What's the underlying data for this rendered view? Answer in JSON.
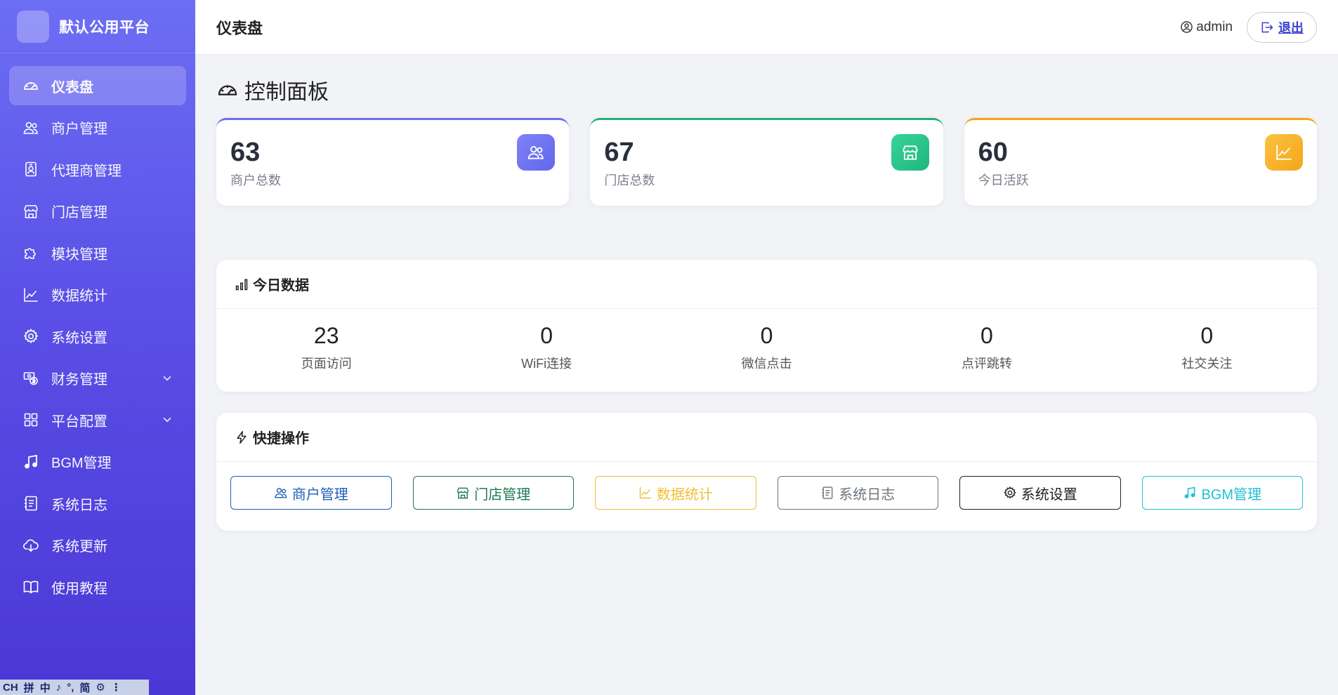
{
  "brand": {
    "name": "默认公用平台"
  },
  "sidebar": {
    "items": [
      {
        "label": "仪表盘",
        "icon": "speedometer-icon",
        "active": true
      },
      {
        "label": "商户管理",
        "icon": "people-icon"
      },
      {
        "label": "代理商管理",
        "icon": "person-badge-icon"
      },
      {
        "label": "门店管理",
        "icon": "shop-icon"
      },
      {
        "label": "模块管理",
        "icon": "puzzle-icon"
      },
      {
        "label": "数据统计",
        "icon": "graph-up-icon"
      },
      {
        "label": "系统设置",
        "icon": "gear-icon"
      },
      {
        "label": "财务管理",
        "icon": "cash-coin-icon",
        "expandable": true
      },
      {
        "label": "平台配置",
        "icon": "grid-icon",
        "expandable": true
      },
      {
        "label": "BGM管理",
        "icon": "music-note-icon"
      },
      {
        "label": "系统日志",
        "icon": "journal-text-icon"
      },
      {
        "label": "系统更新",
        "icon": "cloud-download-icon"
      },
      {
        "label": "使用教程",
        "icon": "book-icon"
      }
    ]
  },
  "ime": {
    "items": [
      "CH",
      "拼",
      "中",
      "♪",
      "°,",
      "简",
      "⚙",
      "⋮"
    ]
  },
  "header": {
    "title": "仪表盘",
    "user": "admin",
    "logout_label": "退出"
  },
  "dashboard": {
    "title": "控制面板",
    "stats": [
      {
        "value": "63",
        "label": "商户总数",
        "accent": "#6a6ef0"
      },
      {
        "value": "67",
        "label": "门店总数",
        "accent": "#22b07a"
      },
      {
        "value": "60",
        "label": "今日活跃",
        "accent": "#f2a51f"
      }
    ]
  },
  "today": {
    "title": "今日数据",
    "metrics": [
      {
        "value": "23",
        "label": "页面访问"
      },
      {
        "value": "0",
        "label": "WiFi连接"
      },
      {
        "value": "0",
        "label": "微信点击"
      },
      {
        "value": "0",
        "label": "点评跳转"
      },
      {
        "value": "0",
        "label": "社交关注"
      }
    ]
  },
  "quick": {
    "title": "快捷操作",
    "buttons": [
      {
        "label": "商户管理",
        "color": "#1f5fb8"
      },
      {
        "label": "门店管理",
        "color": "#1d7a52"
      },
      {
        "label": "数据统计",
        "color": "#f0c033"
      },
      {
        "label": "系统日志",
        "color": "#6c757d"
      },
      {
        "label": "系统设置",
        "color": "#222222"
      },
      {
        "label": "BGM管理",
        "color": "#1fc2d4"
      }
    ]
  }
}
